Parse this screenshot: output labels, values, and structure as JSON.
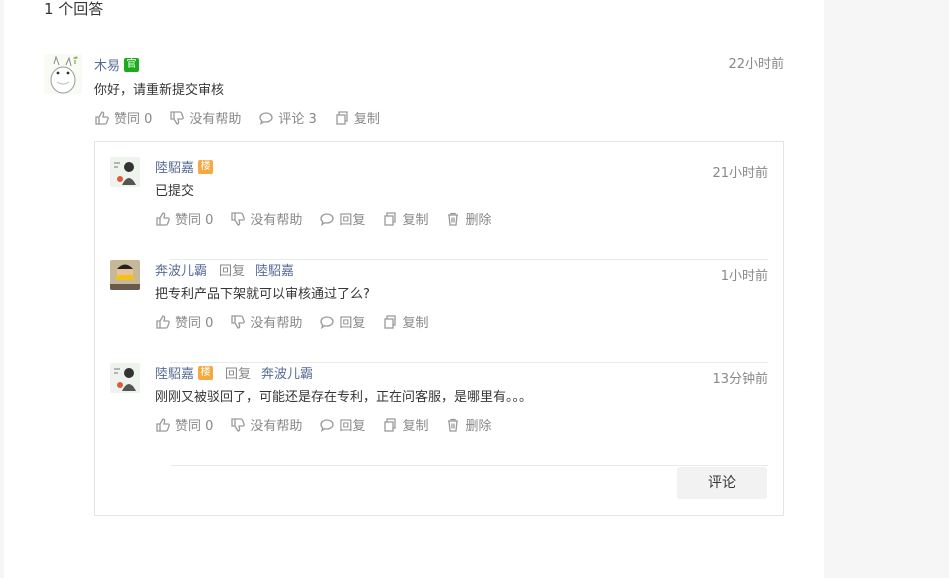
{
  "heading": "1 个回答",
  "answer": {
    "user": "木易",
    "badge": "官",
    "time": "22小时前",
    "content": "你好，请重新提交审核",
    "actions": {
      "like": "赞同 0",
      "unhelpful": "没有帮助",
      "comment": "评论 3",
      "copy": "复制"
    }
  },
  "comments": [
    {
      "user": "陸駋嘉",
      "badge": "楼",
      "reply_word": "",
      "reply_to": "",
      "time": "21小时前",
      "content": "已提交",
      "actions": {
        "like": "赞同 0",
        "unhelpful": "没有帮助",
        "reply": "回复",
        "copy": "复制",
        "delete": "删除"
      }
    },
    {
      "user": "奔波儿霸",
      "badge": "",
      "reply_word": "回复",
      "reply_to": "陸駋嘉",
      "time": "1小时前",
      "content": "把专利产品下架就可以审核通过了么?",
      "actions": {
        "like": "赞同 0",
        "unhelpful": "没有帮助",
        "reply": "回复",
        "copy": "复制"
      }
    },
    {
      "user": "陸駋嘉",
      "badge": "楼",
      "reply_word": "回复",
      "reply_to": "奔波儿霸",
      "time": "13分钟前",
      "content": "刚刚又被驳回了，可能还是存在专利，正在问客服，是哪里有。。。",
      "actions": {
        "like": "赞同 0",
        "unhelpful": "没有帮助",
        "reply": "回复",
        "copy": "复制",
        "delete": "删除"
      }
    }
  ],
  "comment_button": "评论",
  "colors": {
    "link": "#576b95",
    "official": "#1aad19",
    "floor": "#f5a940",
    "muted": "#888888"
  }
}
